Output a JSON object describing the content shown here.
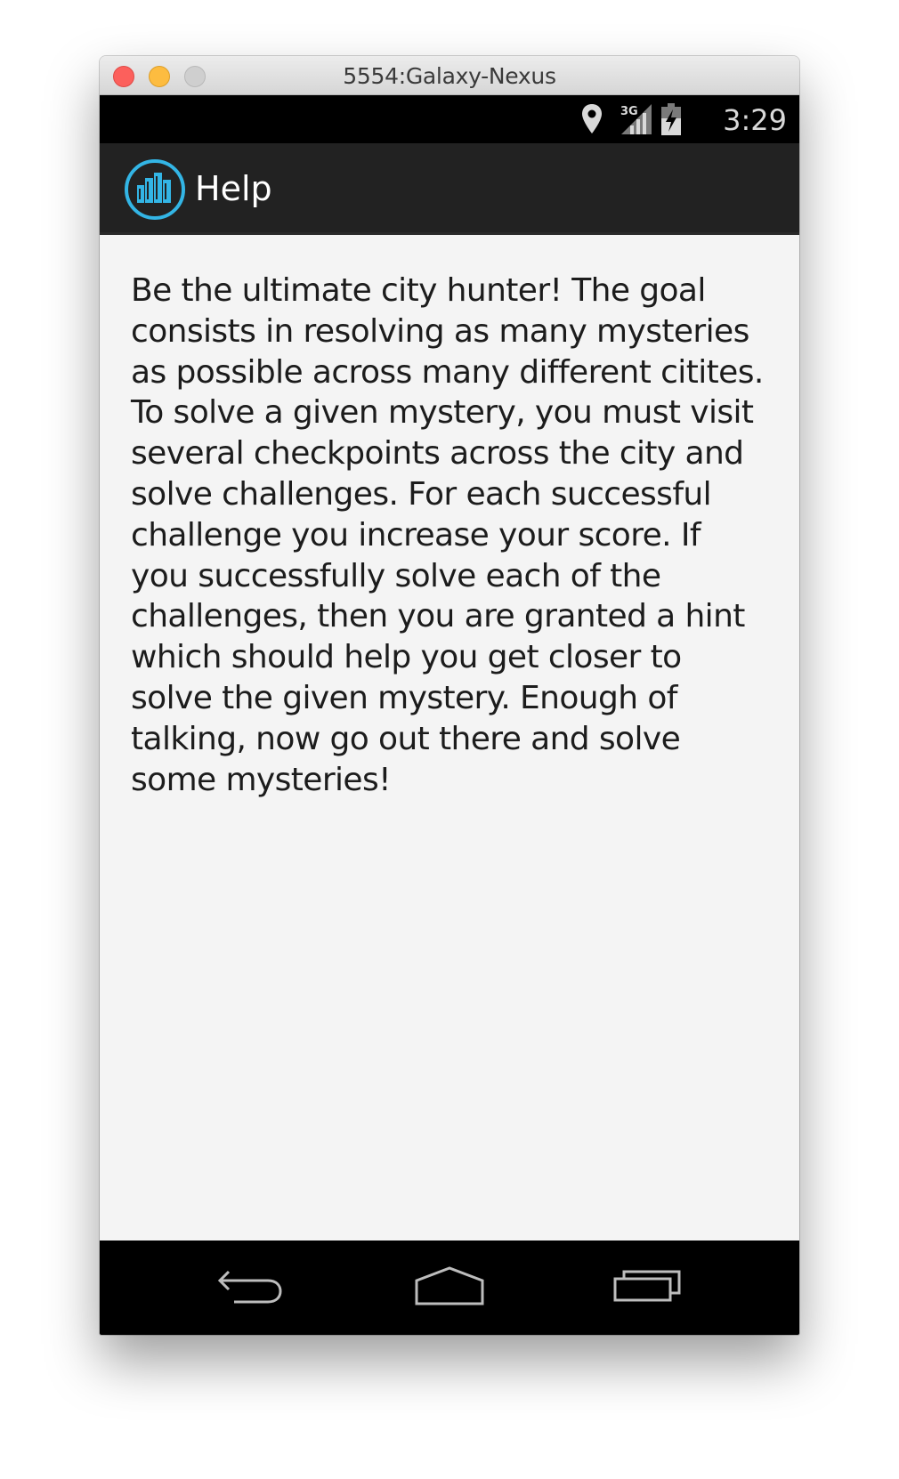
{
  "window": {
    "title": "5554:Galaxy-Nexus"
  },
  "status_bar": {
    "icons": [
      "location-icon",
      "network-3g-icon",
      "battery-icon"
    ],
    "network_label": "3G",
    "time": "3:29"
  },
  "action_bar": {
    "app_icon": "city-buildings-icon",
    "title": "Help",
    "accent_color": "#33b5e5"
  },
  "content": {
    "help_text": "Be the ultimate city hunter! The goal consists in resolving as many mysteries as possible across many different citites. To solve a given mystery, you must visit several checkpoints across the city and solve challenges. For each successful challenge you increase your score. If you successfully solve each of the challenges, then you are granted a hint which should help you get closer to solve the given mystery. Enough of talking, now go out there and solve some mysteries!"
  },
  "nav_bar": {
    "buttons": [
      "back-icon",
      "home-icon",
      "recent-apps-icon"
    ]
  }
}
